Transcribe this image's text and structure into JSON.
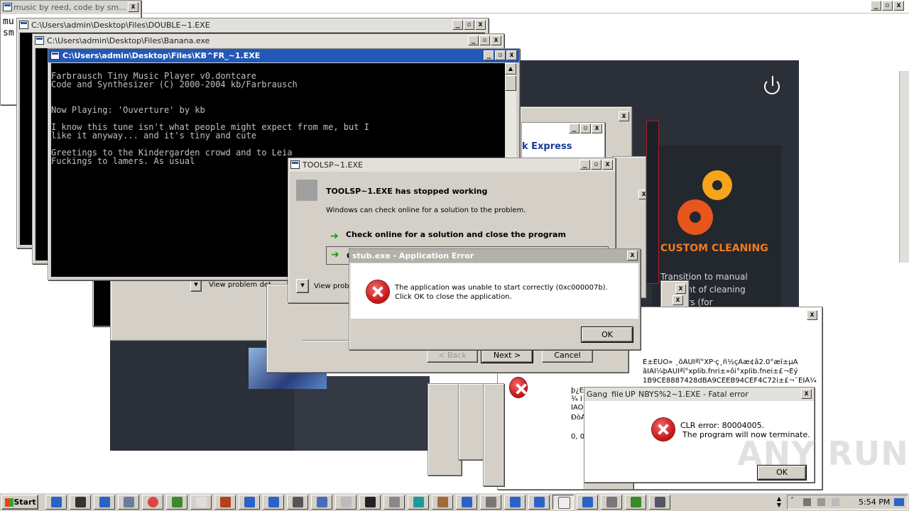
{
  "top_window": {
    "title": "music by reed, code by sm...",
    "text_line1": "mu",
    "text_line2": "sm"
  },
  "windows": {
    "double": {
      "title": "C:\\Users\\admin\\Desktop\\Files\\DOUBLE~1.EXE"
    },
    "banana": {
      "title": "C:\\Users\\admin\\Desktop\\Files\\Banana.exe"
    },
    "kb": {
      "title": "C:\\Users\\admin\\Desktop\\Files\\KB^FR_~1.EXE",
      "lines": [
        "Farbrausch Tiny Music Player v0.dontcare",
        "Code and Synthesizer (C) 2000-2004 kb/Farbrausch",
        "",
        "",
        "Now Playing: 'Ouverture' by kb",
        "",
        "I know this tune isn't what people might expect from me, but I",
        "like it anyway... and it's tiny and cute",
        "",
        "Greetings to the Kindergarden crowd and to Leia",
        "Fuckings to lamers. As usual"
      ]
    },
    "toolsp": {
      "title": "TOOLSP~1.EXE",
      "heading": "TOOLSP~1.EXE has stopped working",
      "message": "Windows can check online for a solution to the problem.",
      "option1": "Check online for a solution and close the program",
      "option2_prefix": "C",
      "view_problem": "View probl",
      "view_problem_bg": "View problem det"
    },
    "stub": {
      "title": "stub.exe - Application Error",
      "message": "The application was unable to start correctly (0xc000007b). Click OK to close the application.",
      "ok": "OK"
    },
    "wizard": {
      "back": "< Back",
      "next": "Next >",
      "cancel": "Cancel"
    },
    "express": {
      "partial_title": "k Express"
    },
    "cleaner": {
      "heading": "CUSTOM CLEANING",
      "line1": "Transition to manual",
      "line2": "ent of cleaning",
      "line3": "ers (for"
    },
    "garbled": {
      "lines": [
        "È±ÉÙÒ» ¸õÂÛÎªï°XP·ç¸ñ½çÃæ¢â2.0°æï±µÄ",
        "ãÏÂÎ¼þÂÛÎªï°xplib.fnri±»ôi°xplib.fnei±£¬Èý",
        "1B9CE8887428dBA9CEEB94CEF4C72i±£¬¨ËÏÂ¼"
      ],
      "side": [
        "þ¿Ë",
        "¾ Ì",
        "ÌÃÔ",
        "ÐòÀ",
        "",
        "0, 0"
      ]
    },
    "fatal": {
      "tabs": [
        "Gang",
        "file",
        "UP"
      ],
      "title": "NBYS%2~1.EXE - Fatal error",
      "line1": "CLR error: 80004005.",
      "line2": "The program will now terminate.",
      "ok": "OK"
    }
  },
  "taskbar": {
    "start": "Start",
    "clock": "5:54 PM"
  },
  "watermark": "ANY RUN",
  "colors": {
    "active_title": "#2458b6",
    "console_bg": "#000000",
    "cleaner_bg": "#2a2f38",
    "cleaner_accent": "#f07c1c",
    "error_red": "#c41212"
  }
}
